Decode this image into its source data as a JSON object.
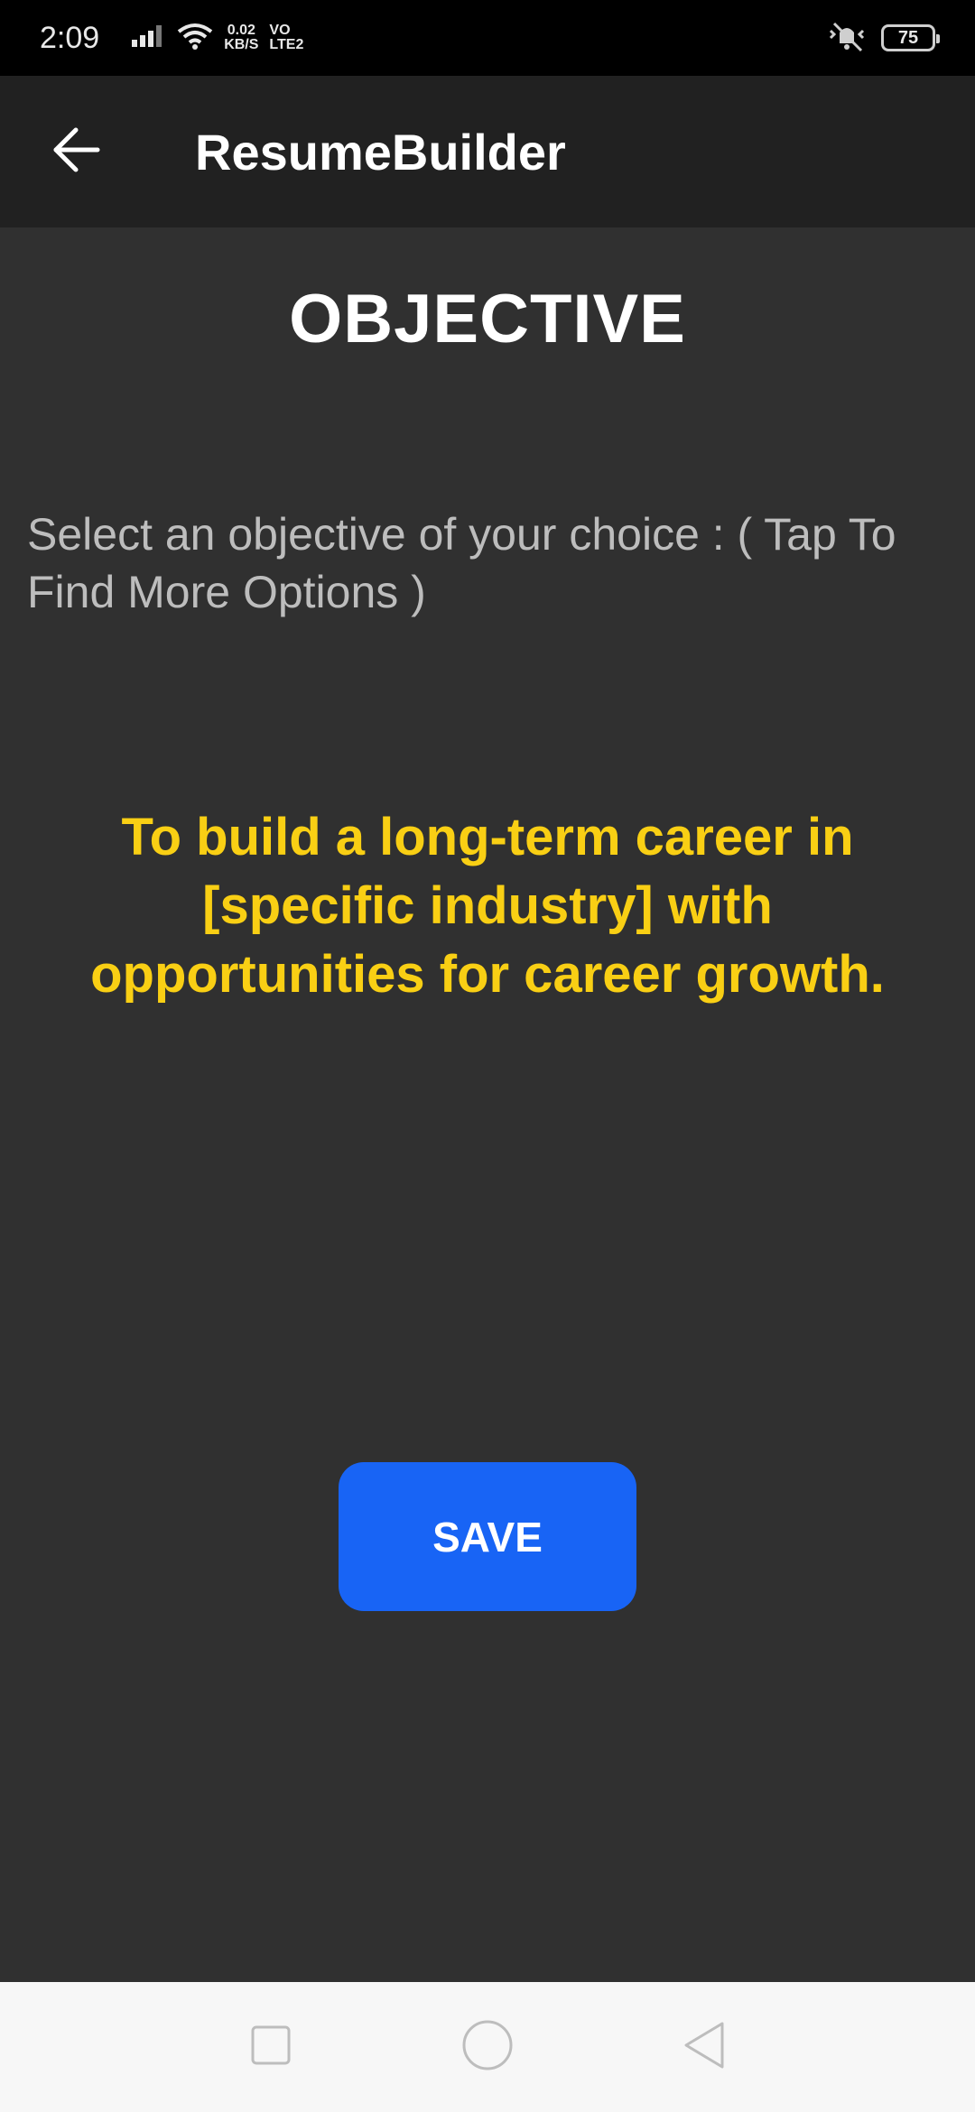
{
  "status_bar": {
    "time": "2:09",
    "net_speed_value": "0.02",
    "net_speed_unit": "KB/S",
    "volte_top": "VO",
    "volte_bottom": "LTE2",
    "battery": "75"
  },
  "app_bar": {
    "title": "ResumeBuilder",
    "back_icon": "arrow-left-icon"
  },
  "main": {
    "heading": "OBJECTIVE",
    "instruction": "Select an objective of your choice : ( Tap To Find More Options )",
    "objective": "To build a long-term career in [specific industry] with opportunities for career growth.",
    "save_label": "SAVE"
  },
  "nav_bar": {
    "recent_icon": "square-icon",
    "home_icon": "circle-icon",
    "back_icon": "triangle-back-icon"
  },
  "colors": {
    "background": "#303030",
    "app_bar": "#212121",
    "objective_text": "#f9cf14",
    "save_button": "#1864f5"
  }
}
